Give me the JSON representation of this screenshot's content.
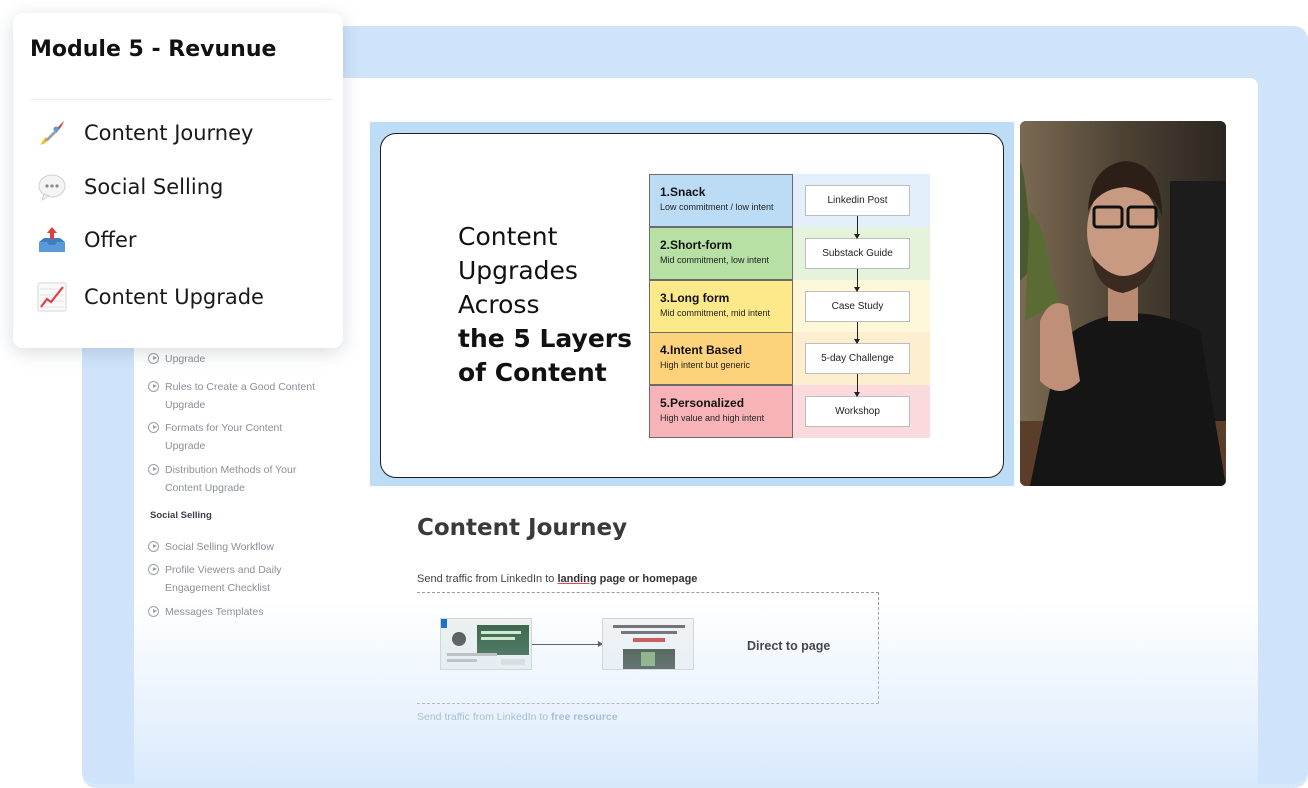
{
  "module": {
    "title": "Module 5 - Revunue",
    "items": [
      {
        "label": "Content Journey",
        "icon": "rocket-icon"
      },
      {
        "label": "Social Selling",
        "icon": "speech-bubble-icon"
      },
      {
        "label": "Offer",
        "icon": "outbox-tray-icon"
      },
      {
        "label": "Content Upgrade",
        "icon": "chart-increasing-icon"
      }
    ]
  },
  "sidebar": {
    "partial_item": "Upgrade",
    "upgrade_items": [
      "Rules to Create a Good Content Upgrade",
      "Formats for Your Content Upgrade",
      "Distribution Methods of Your Content Upgrade"
    ],
    "section_heading": "Social Selling",
    "social_items": [
      "Social Selling Workflow",
      "Profile Viewers and Daily Engagement Checklist",
      "Messages Templates"
    ]
  },
  "slide": {
    "title_lines": [
      "Content",
      "Upgrades",
      "Across"
    ],
    "title_bold_lines": [
      "the 5 Layers",
      "of Content"
    ],
    "layers": [
      {
        "title": "1.Snack",
        "subtitle": "Low commitment / low intent",
        "step": "Linkedin Post",
        "color": "#bcdcf6",
        "tint": "#e3effb"
      },
      {
        "title": "2.Short-form",
        "subtitle": "Mid commitment, low intent",
        "step": "Substack Guide",
        "color": "#b6e0a4",
        "tint": "#e5f3dc"
      },
      {
        "title": "3.Long form",
        "subtitle": "Mid commitment, mid intent",
        "step": "Case Study",
        "color": "#fde98a",
        "tint": "#fff8d8"
      },
      {
        "title": "4.Intent Based",
        "subtitle": "High intent but generic",
        "step": "5-day Challenge",
        "color": "#fcd27a",
        "tint": "#fdeed0"
      },
      {
        "title": "5.Personalized",
        "subtitle": "High value and high intent",
        "step": "Workshop",
        "color": "#f8b3b8",
        "tint": "#fbdadd"
      }
    ]
  },
  "content": {
    "heading": "Content Journey",
    "line1_prefix": "Send traffic from LinkedIn to ",
    "line1_underlined": "landing",
    "line1_rest": " page or homepage",
    "direct_label": "Direct to page",
    "line2_prefix": "Send traffic from LinkedIn to ",
    "line2_bold": "free resource"
  },
  "colors": {
    "frame": "#cfe4fb",
    "slide_bg": "#bdddf6"
  }
}
